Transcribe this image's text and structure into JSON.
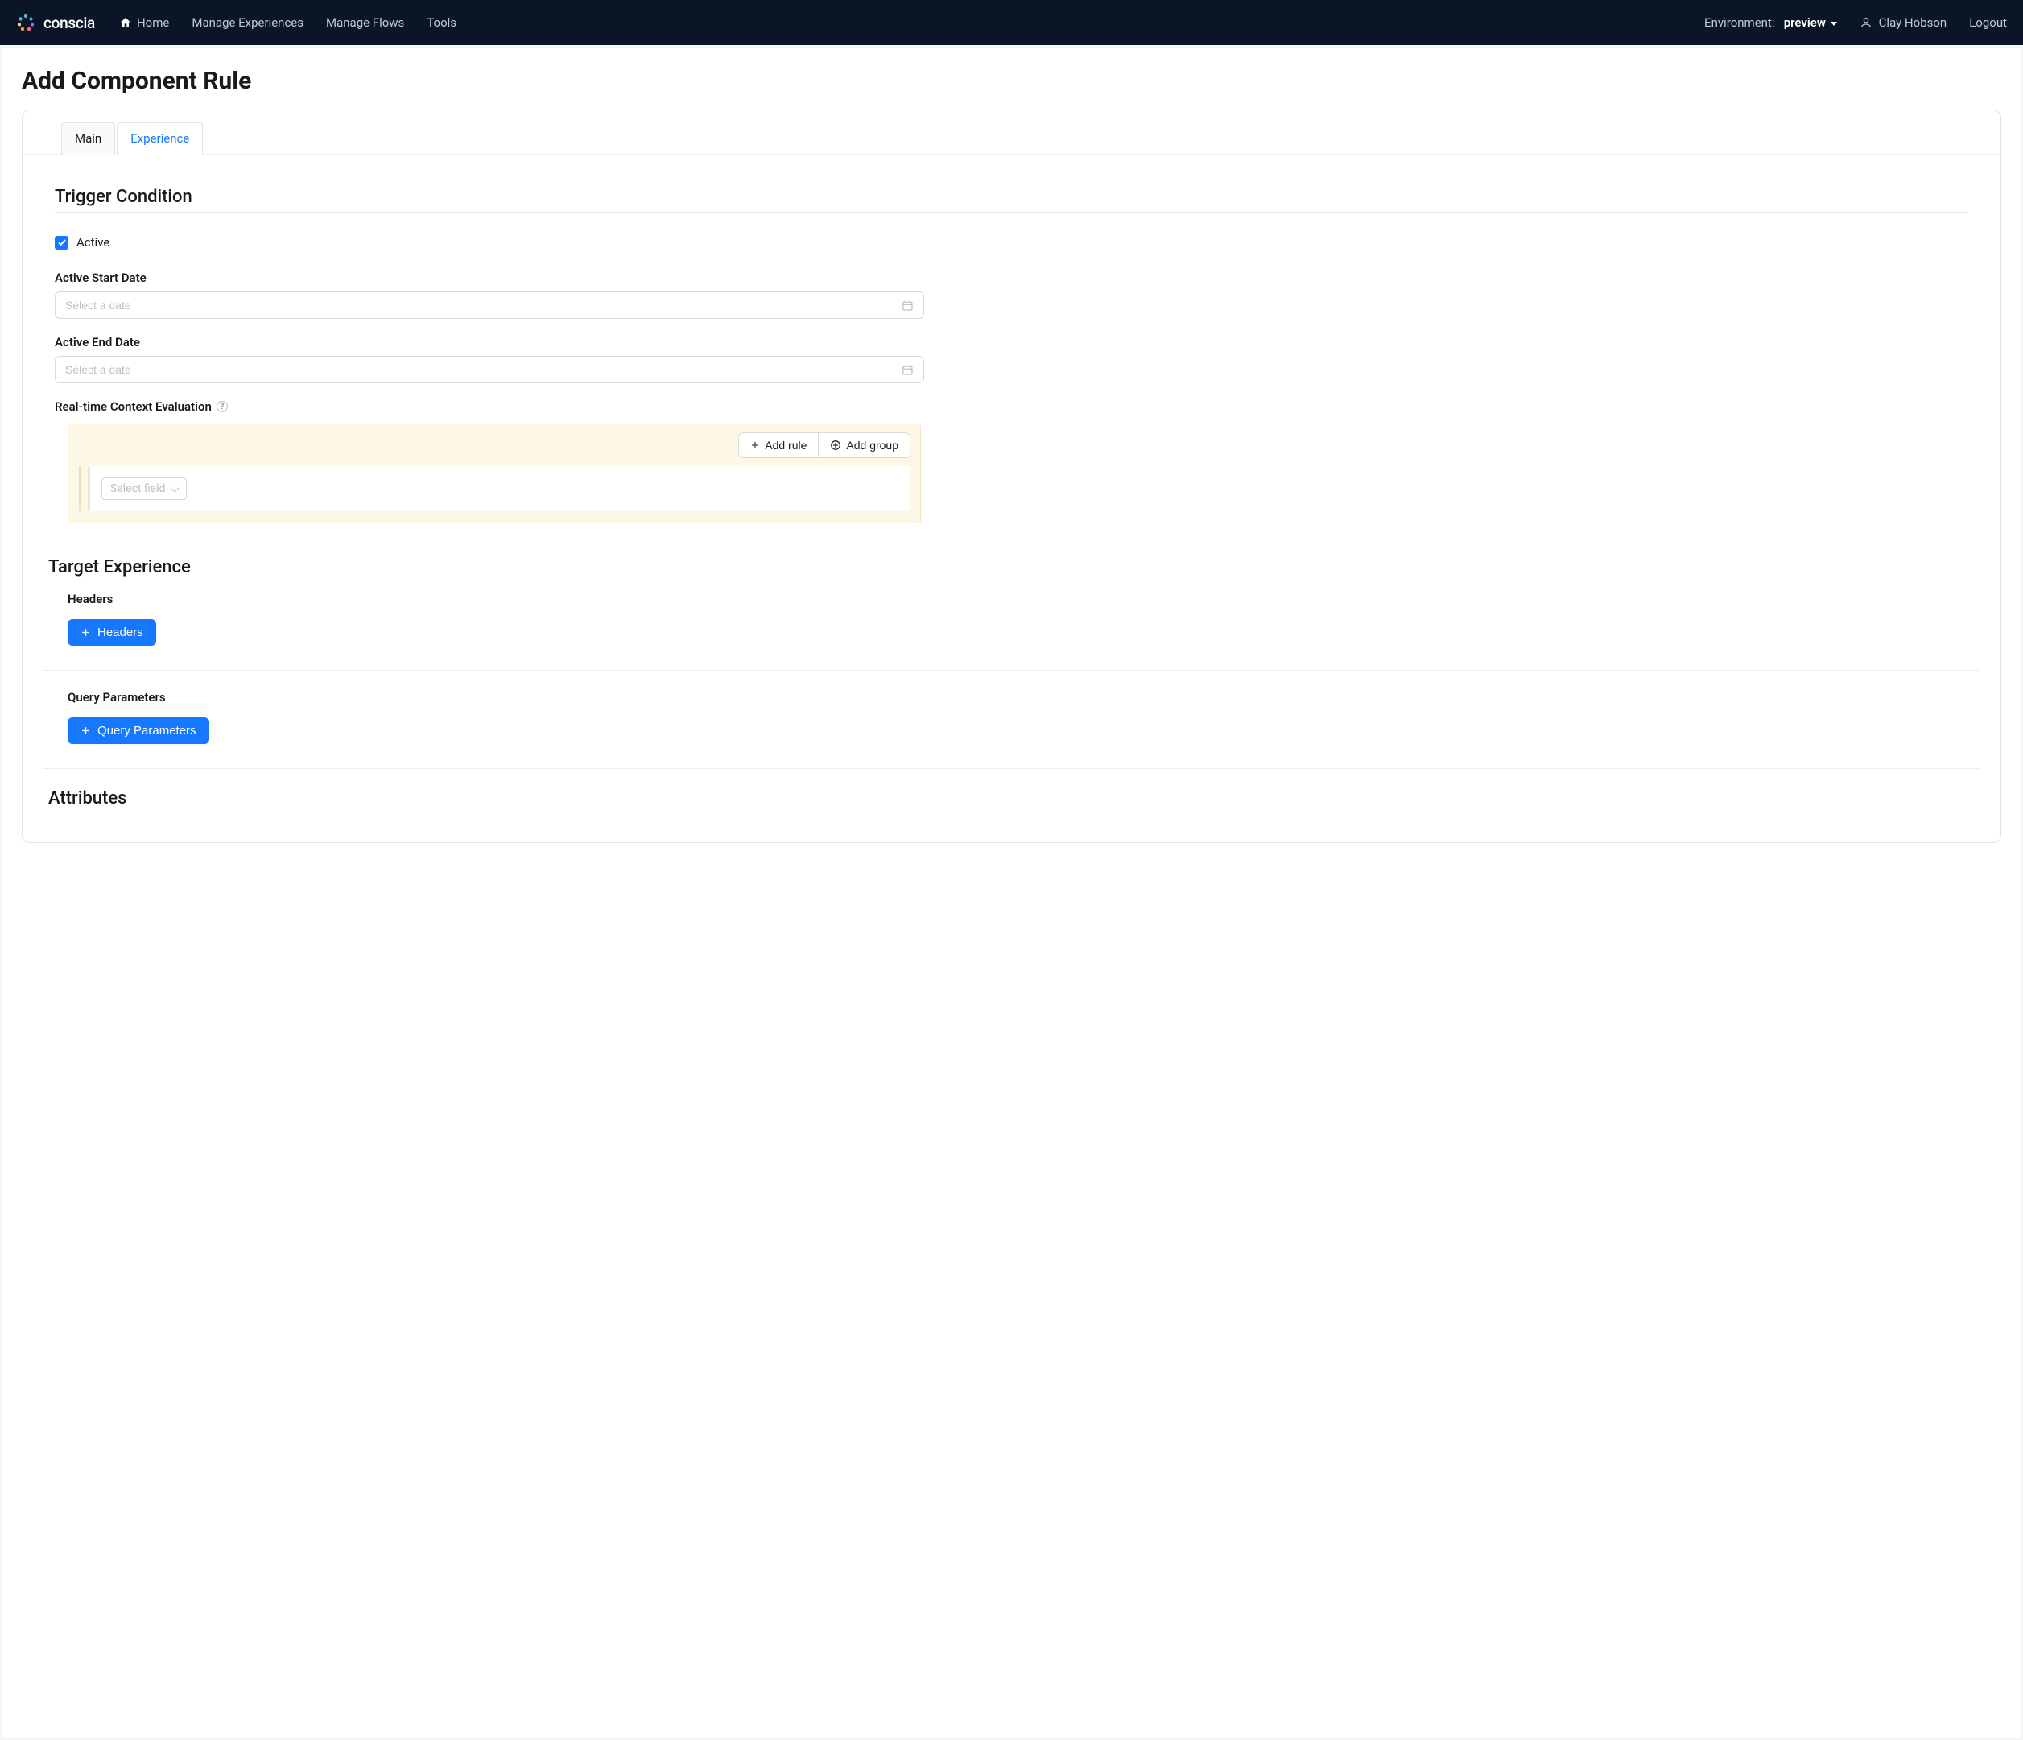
{
  "navbar": {
    "brand": "conscia",
    "links": {
      "home": "Home",
      "manage_experiences": "Manage Experiences",
      "manage_flows": "Manage Flows",
      "tools": "Tools"
    },
    "env_label": "Environment:",
    "env_value": "preview",
    "user": "Clay Hobson",
    "logout": "Logout"
  },
  "page": {
    "title": "Add Component Rule",
    "tabs": {
      "main": "Main",
      "experience": "Experience"
    }
  },
  "trigger": {
    "title": "Trigger Condition",
    "active_label": "Active",
    "start_date_label": "Active Start Date",
    "end_date_label": "Active End Date",
    "date_placeholder": "Select a date",
    "context_label": "Real-time Context Evaluation",
    "add_rule": "Add rule",
    "add_group": "Add group",
    "select_field_placeholder": "Select field"
  },
  "target": {
    "title": "Target Experience",
    "headers_label": "Headers",
    "headers_button": "Headers",
    "params_label": "Query Parameters",
    "params_button": "Query Parameters"
  },
  "attributes": {
    "title": "Attributes"
  }
}
